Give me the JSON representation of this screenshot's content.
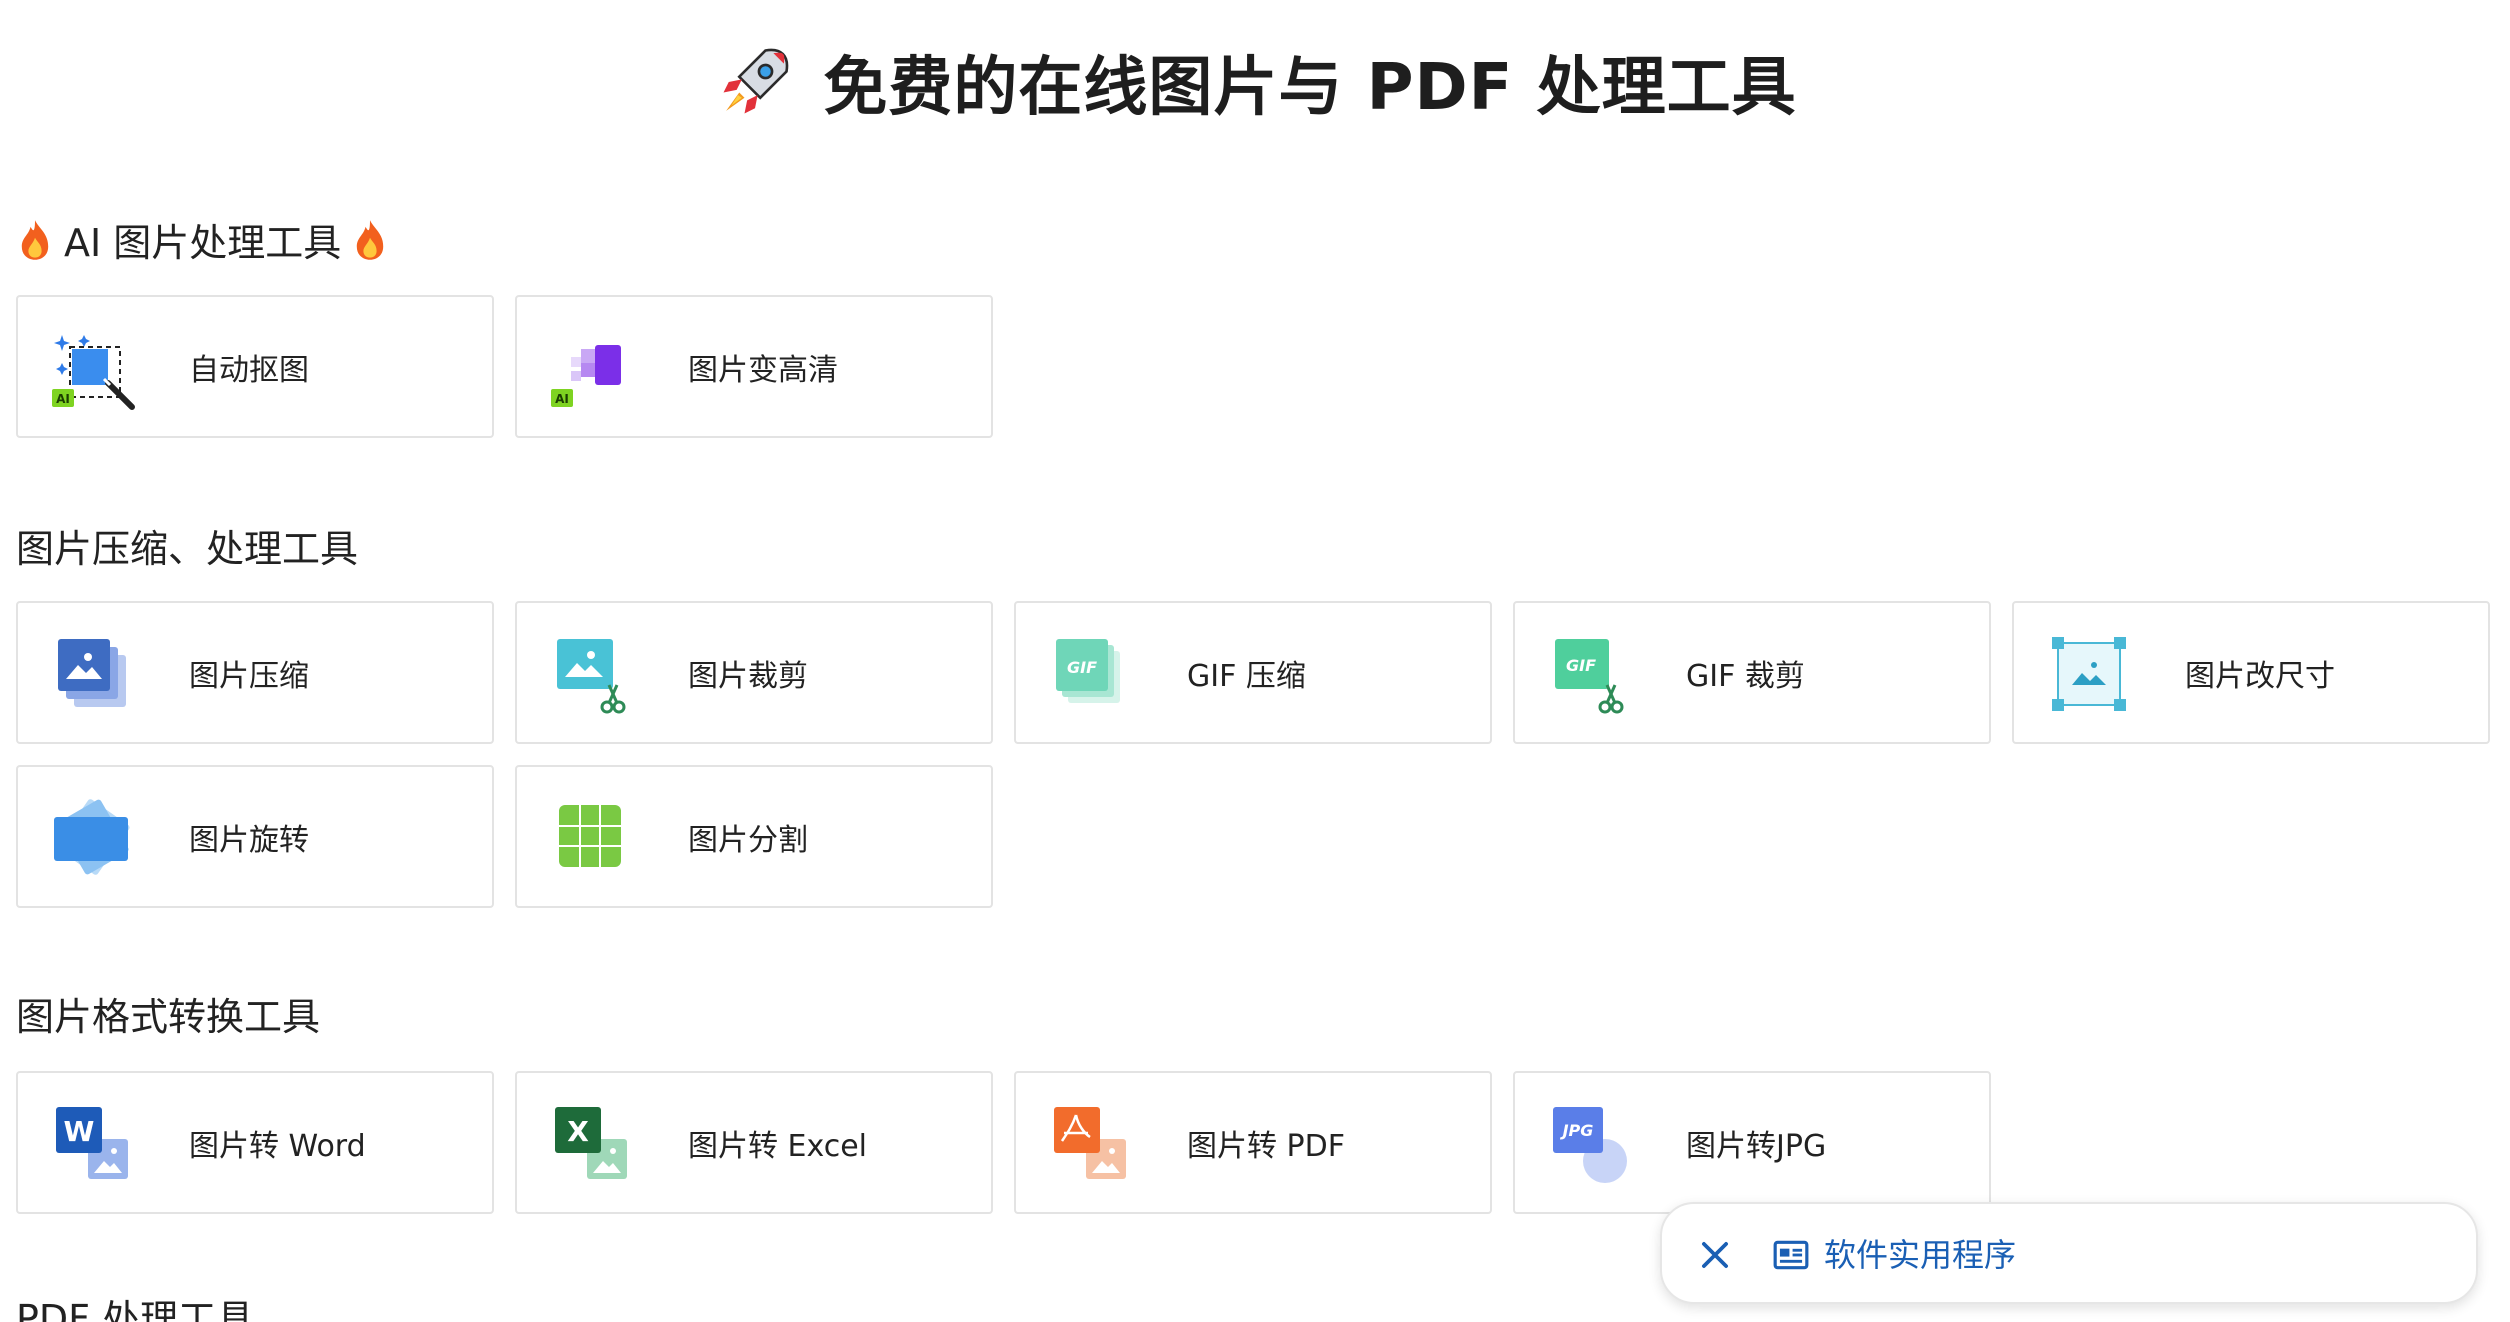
{
  "header": {
    "title": "免费的在线图片与 PDF 处理工具",
    "icon": "rocket-icon"
  },
  "sections": [
    {
      "title": "AI 图片处理工具",
      "decor_icon": "fire-icon",
      "tools": [
        {
          "label": "自动抠图",
          "icon": "ai-cutout-icon"
        },
        {
          "label": "图片变高清",
          "icon": "ai-upscale-icon"
        }
      ]
    },
    {
      "title": "图片压缩、处理工具",
      "tools": [
        {
          "label": "图片压缩",
          "icon": "image-compress-icon"
        },
        {
          "label": "图片裁剪",
          "icon": "image-crop-icon"
        },
        {
          "label": "GIF 压缩",
          "icon": "gif-compress-icon"
        },
        {
          "label": "GIF 裁剪",
          "icon": "gif-crop-icon"
        },
        {
          "label": "图片改尺寸",
          "icon": "image-resize-icon"
        },
        {
          "label": "图片旋转",
          "icon": "image-rotate-icon"
        },
        {
          "label": "图片分割",
          "icon": "image-split-icon"
        }
      ]
    },
    {
      "title": "图片格式转换工具",
      "tools": [
        {
          "label": "图片转 Word",
          "icon": "word-icon"
        },
        {
          "label": "图片转 Excel",
          "icon": "excel-icon"
        },
        {
          "label": "图片转 PDF",
          "icon": "pdf-icon"
        },
        {
          "label": "图片转JPG",
          "icon": "jpg-icon"
        }
      ]
    },
    {
      "title": "PDF 处理工具"
    }
  ],
  "toast": {
    "label": "软件实用程序",
    "close_icon": "close-icon",
    "app_icon": "app-window-icon"
  },
  "colors": {
    "accent": "#1a5fb4",
    "card_border": "#e3e3e3",
    "text": "#222222"
  }
}
